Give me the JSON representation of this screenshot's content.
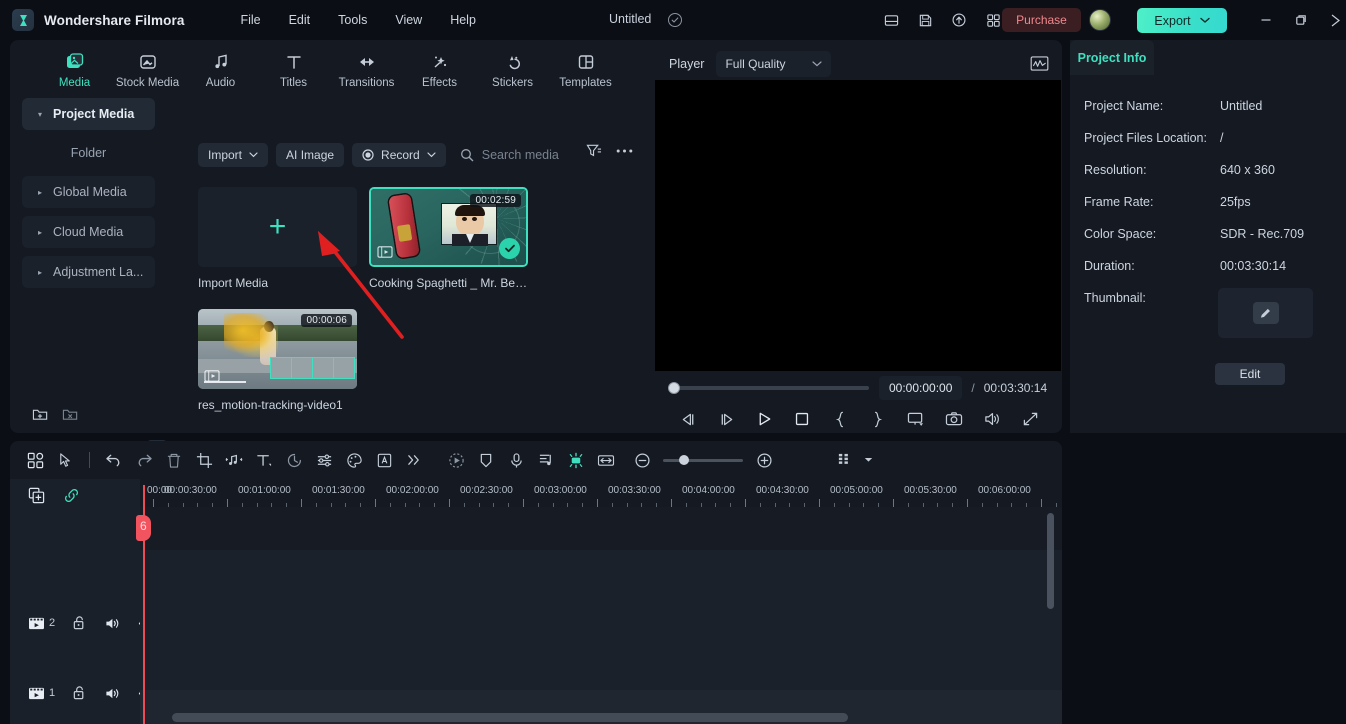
{
  "titlebar": {
    "app_name": "Wondershare Filmora",
    "logo_icon": "filmora-logo-icon",
    "menus": [
      "File",
      "Edit",
      "Tools",
      "View",
      "Help"
    ],
    "document_title": "Untitled",
    "saved_check_icon": "check-circle-icon",
    "icons": [
      "layout-panel-icon",
      "save-disk-icon",
      "cloud-upload-icon",
      "apps-grid-icon"
    ],
    "purchase_label": "Purchase",
    "avatar_icon": "user-avatar",
    "export_label": "Export",
    "export_caret_icon": "chevron-down-icon",
    "window_minimize_icon": "minimize-icon",
    "window_restore_icon": "restore-icon",
    "window_close_icon": "close-icon"
  },
  "tabs": [
    {
      "label": "Media",
      "icon": "media-icon",
      "active": true
    },
    {
      "label": "Stock Media",
      "icon": "stock-media-icon",
      "active": false
    },
    {
      "label": "Audio",
      "icon": "audio-note-icon",
      "active": false
    },
    {
      "label": "Titles",
      "icon": "titles-text-icon",
      "active": false
    },
    {
      "label": "Transitions",
      "icon": "transitions-arrows-icon",
      "active": false
    },
    {
      "label": "Effects",
      "icon": "effects-wand-icon",
      "active": false
    },
    {
      "label": "Stickers",
      "icon": "stickers-icon",
      "active": false
    },
    {
      "label": "Templates",
      "icon": "templates-grid-icon",
      "active": false
    }
  ],
  "sidebar": {
    "items": [
      {
        "label": "Project Media",
        "selected": true,
        "caret": "caret-down-icon"
      },
      {
        "label": "Folder",
        "selected": false,
        "caret": ""
      },
      {
        "label": "Global Media",
        "selected": false,
        "caret": "caret-right-icon"
      },
      {
        "label": "Cloud Media",
        "selected": false,
        "caret": "caret-right-icon"
      },
      {
        "label": "Adjustment La...",
        "selected": false,
        "caret": "caret-right-icon"
      }
    ],
    "new_folder_icon": "new-folder-icon",
    "delete_folder_icon": "delete-folder-icon",
    "collapse_icon": "chevron-left-icon"
  },
  "media_toolbar": {
    "import_label": "Import",
    "import_caret_icon": "chevron-down-icon",
    "ai_image_label": "AI Image",
    "record_label": "Record",
    "record_dot_icon": "record-circle-icon",
    "record_caret_icon": "chevron-down-icon",
    "search_icon": "search-icon",
    "search_placeholder": "Search media",
    "search_value": "",
    "filter_icon": "filter-icon",
    "more_icon": "more-horizontal-icon"
  },
  "media_items": [
    {
      "kind": "import",
      "label": "Import Media",
      "plus_icon": "plus-icon",
      "duration": "",
      "selected": false
    },
    {
      "kind": "video",
      "label": "Cooking Spaghetti _ Mr. Bea...",
      "duration": "00:02:59",
      "selected": true,
      "check_icon": "check-badge-icon",
      "film_icon": "film-clip-icon"
    },
    {
      "kind": "video",
      "label": "res_motion-tracking-video1",
      "duration": "00:00:06",
      "selected": false,
      "film_icon": "film-clip-icon"
    }
  ],
  "player": {
    "label": "Player",
    "quality_value": "Full Quality",
    "quality_caret_icon": "chevron-down-icon",
    "scope_icon": "waveform-scope-icon",
    "current_time": "00:00:00:00",
    "separator": "/",
    "total_time": "00:03:30:14",
    "buttons": [
      {
        "icon": "prev-frame-icon",
        "name": "previous-frame-button"
      },
      {
        "icon": "next-frame-icon",
        "name": "next-frame-button"
      },
      {
        "icon": "play-icon",
        "name": "play-button"
      },
      {
        "icon": "stop-icon",
        "name": "stop-button"
      },
      {
        "icon": "mark-in-icon",
        "name": "mark-in-button"
      },
      {
        "icon": "mark-out-icon",
        "name": "mark-out-button"
      },
      {
        "icon": "display-mode-icon",
        "name": "display-mode-button"
      },
      {
        "icon": "snapshot-camera-icon",
        "name": "snapshot-button"
      },
      {
        "icon": "volume-icon",
        "name": "volume-button"
      },
      {
        "icon": "fullscreen-icon",
        "name": "fullscreen-button"
      }
    ]
  },
  "project_info": {
    "tab_label": "Project Info",
    "rows": [
      {
        "key": "Project Name:",
        "value": "Untitled"
      },
      {
        "key": "Project Files Location:",
        "value": "/"
      },
      {
        "key": "Resolution:",
        "value": "640 x 360"
      },
      {
        "key": "Frame Rate:",
        "value": "25fps"
      },
      {
        "key": "Color Space:",
        "value": "SDR - Rec.709"
      },
      {
        "key": "Duration:",
        "value": "00:03:30:14"
      },
      {
        "key": "Thumbnail:",
        "value": ""
      }
    ],
    "thumbnail_edit_icon": "thumbnail-pencil-icon",
    "edit_label": "Edit"
  },
  "timeline_toolbar": {
    "left_buttons": [
      {
        "icon": "template-grid-icon",
        "name": "timeline-templates-button"
      },
      {
        "icon": "select-cursor-icon",
        "name": "select-tool-button"
      },
      {
        "icon": "split-icon",
        "name": "split-button"
      },
      {
        "icon": "undo-icon",
        "name": "undo-button"
      },
      {
        "icon": "redo-icon",
        "name": "redo-button"
      },
      {
        "icon": "trash-icon",
        "name": "delete-button"
      },
      {
        "icon": "crop-icon",
        "name": "crop-button"
      },
      {
        "icon": "audio-detach-icon",
        "name": "detach-audio-button"
      },
      {
        "icon": "text-icon",
        "name": "add-text-button"
      },
      {
        "icon": "speed-icon",
        "name": "speed-button"
      },
      {
        "icon": "adjust-sliders-icon",
        "name": "adjust-button"
      },
      {
        "icon": "color-palette-icon",
        "name": "color-button"
      },
      {
        "icon": "mask-icon",
        "name": "mask-button"
      },
      {
        "icon": "more-chevrons-icon",
        "name": "more-tools-button"
      }
    ],
    "right_buttons": [
      {
        "icon": "auto-reframe-icon",
        "name": "auto-reframe-button"
      },
      {
        "icon": "shield-marker-icon",
        "name": "marker-button"
      },
      {
        "icon": "microphone-icon",
        "name": "voiceover-button"
      },
      {
        "icon": "beat-detect-icon",
        "name": "beat-detect-button"
      },
      {
        "icon": "render-preview-icon",
        "name": "render-preview-button",
        "active": true
      },
      {
        "icon": "fit-timeline-icon",
        "name": "fit-timeline-button"
      },
      {
        "icon": "zoom-out-icon",
        "name": "zoom-out-button"
      },
      {
        "icon": "zoom-in-icon",
        "name": "zoom-in-button"
      },
      {
        "icon": "track-settings-icon",
        "name": "track-settings-button"
      },
      {
        "icon": "caret-down-icon",
        "name": "track-settings-caret"
      }
    ]
  },
  "timeline": {
    "add_track_icon": "add-track-icon",
    "link_icon": "link-icon",
    "ruler_ticks": [
      "00:00",
      "00:00:30:00",
      "00:01:00:00",
      "00:01:30:00",
      "00:02:00:00",
      "00:02:30:00",
      "00:03:00:00",
      "00:03:30:00",
      "00:04:00:00",
      "00:04:30:00",
      "00:05:00:00",
      "00:05:30:00",
      "00:06:00:00"
    ],
    "tracks": [
      {
        "number": "2",
        "lock_icon": "unlock-icon",
        "mute_icon": "speaker-icon",
        "eye_icon": "eye-icon"
      },
      {
        "number": "1",
        "lock_icon": "unlock-icon",
        "mute_icon": "speaker-icon",
        "eye_icon": "eye-icon"
      }
    ],
    "playhead_label": "6"
  },
  "annotation": {
    "arrow": "red-pointer-arrow",
    "color": "#e02020"
  },
  "colors": {
    "accent": "#3fe0c0",
    "panel": "#151a22",
    "background": "#0b0e14",
    "playhead": "#ef4b57",
    "purchase": "#f0888e"
  }
}
